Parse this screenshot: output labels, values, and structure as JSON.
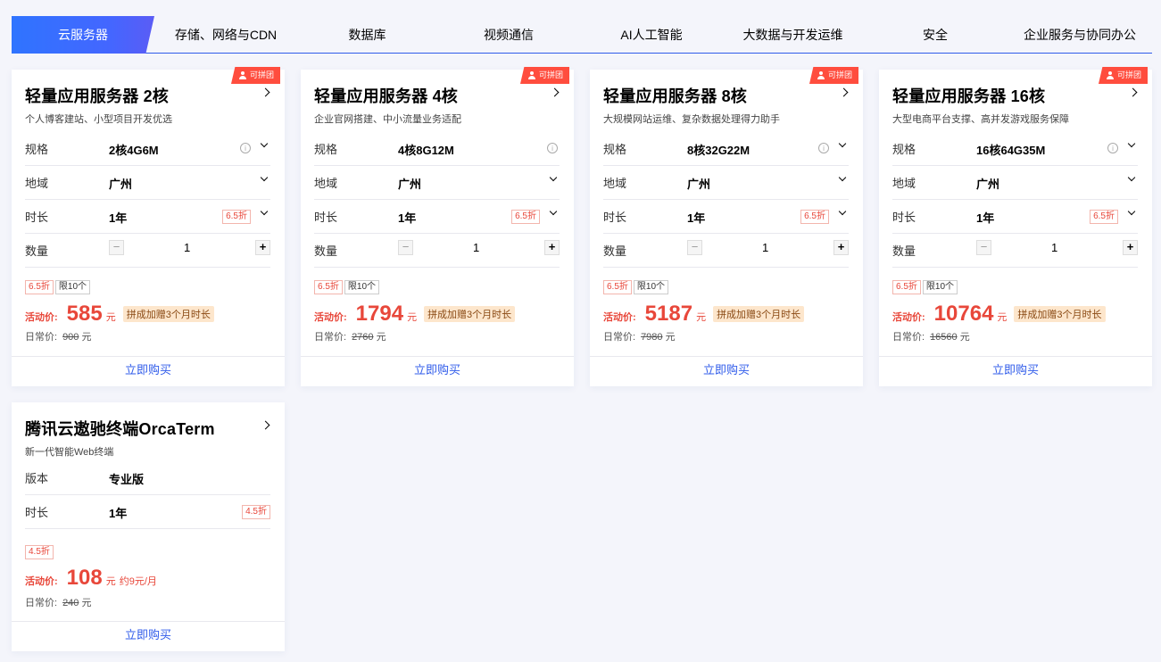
{
  "tabs": [
    {
      "label": "云服务器",
      "active": true
    },
    {
      "label": "存储、网络与CDN",
      "active": false
    },
    {
      "label": "数据库",
      "active": false
    },
    {
      "label": "视频通信",
      "active": false
    },
    {
      "label": "AI人工智能",
      "active": false
    },
    {
      "label": "大数据与开发运维",
      "active": false
    },
    {
      "label": "安全",
      "active": false
    },
    {
      "label": "企业服务与协同办公",
      "active": false
    }
  ],
  "labels": {
    "spec": "规格",
    "region": "地域",
    "duration": "时长",
    "quantity": "数量",
    "edition": "版本",
    "activity_price": "活动价:",
    "regular_price": "日常价:",
    "unit": "元",
    "buy": "立即购买",
    "group_badge": "可拼团",
    "info_icon": "i",
    "minus": "−",
    "plus": "+"
  },
  "cards": [
    {
      "title": "轻量应用服务器 2核",
      "subtitle": "个人博客建站、小型项目开发优选",
      "spec": "2核4G6M",
      "region": "广州",
      "duration": "1年",
      "duration_discount": "6.5折",
      "quantity": "1",
      "discount_tag": "6.5折",
      "limit_tag": "限10个",
      "price": "585",
      "promo": "拼成加赠3个月时长",
      "original_price": "900",
      "groupable": true
    },
    {
      "title": "轻量应用服务器 4核",
      "subtitle": "企业官网搭建、中小流量业务适配",
      "spec": "4核8G12M",
      "region": "广州",
      "duration": "1年",
      "duration_discount": "6.5折",
      "quantity": "1",
      "discount_tag": "6.5折",
      "limit_tag": "限10个",
      "price": "1794",
      "promo": "拼成加赠3个月时长",
      "original_price": "2760",
      "groupable": true
    },
    {
      "title": "轻量应用服务器 8核",
      "subtitle": "大规模网站运维、复杂数据处理得力助手",
      "spec": "8核32G22M",
      "region": "广州",
      "duration": "1年",
      "duration_discount": "6.5折",
      "quantity": "1",
      "discount_tag": "6.5折",
      "limit_tag": "限10个",
      "price": "5187",
      "promo": "拼成加赠3个月时长",
      "original_price": "7980",
      "groupable": true
    },
    {
      "title": "轻量应用服务器 16核",
      "subtitle": "大型电商平台支撑、高并发游戏服务保障",
      "spec": "16核64G35M",
      "region": "广州",
      "duration": "1年",
      "duration_discount": "6.5折",
      "quantity": "1",
      "discount_tag": "6.5折",
      "limit_tag": "限10个",
      "price": "10764",
      "promo": "拼成加赠3个月时长",
      "original_price": "16560",
      "groupable": true
    }
  ],
  "terminal_card": {
    "title": "腾讯云遨驰终端OrcaTerm",
    "subtitle": "新一代智能Web终端",
    "edition": "专业版",
    "duration": "1年",
    "duration_discount": "4.5折",
    "discount_tag": "4.5折",
    "price": "108",
    "price_note": "约9元/月",
    "original_price": "240"
  },
  "colors": {
    "accent_blue": "#2f5bea",
    "price_red": "#e8473a",
    "badge_red": "#ff4d3e",
    "promo_bg": "#fde6cc"
  }
}
